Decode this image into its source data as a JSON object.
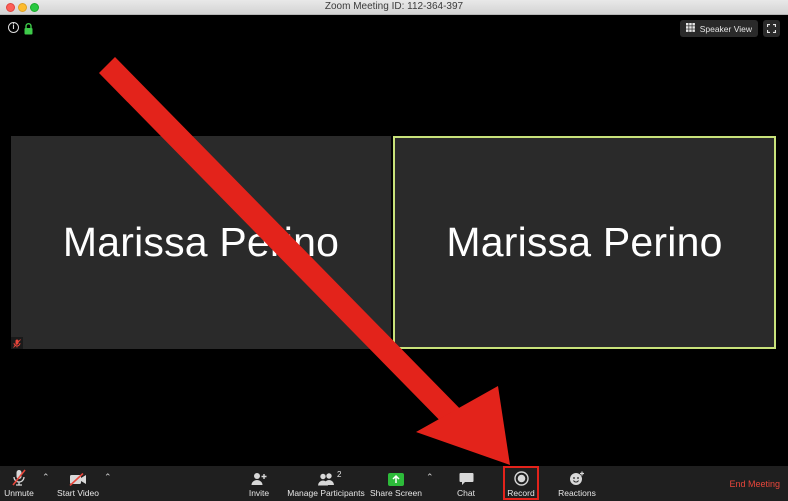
{
  "window": {
    "title": "Zoom Meeting ID: 112-364-397"
  },
  "view": {
    "speaker_view_label": "Speaker View"
  },
  "participants": [
    {
      "name": "Marissa Perino",
      "muted": true,
      "active_speaker": false
    },
    {
      "name": "Marissa Perino",
      "muted": false,
      "active_speaker": true
    }
  ],
  "toolbar": {
    "unmute": "Unmute",
    "start_video": "Start Video",
    "invite": "Invite",
    "manage_participants": "Manage Participants",
    "participants_count": "2",
    "share_screen": "Share Screen",
    "chat": "Chat",
    "record": "Record",
    "reactions": "Reactions",
    "end_meeting": "End Meeting"
  },
  "colors": {
    "active_speaker_border": "#c8e27a",
    "share_green": "#2dbb3a",
    "end_meeting_red": "#e8463b",
    "annotation_red": "#e3231b"
  },
  "annotation": {
    "type": "arrow",
    "target": "record-button"
  }
}
